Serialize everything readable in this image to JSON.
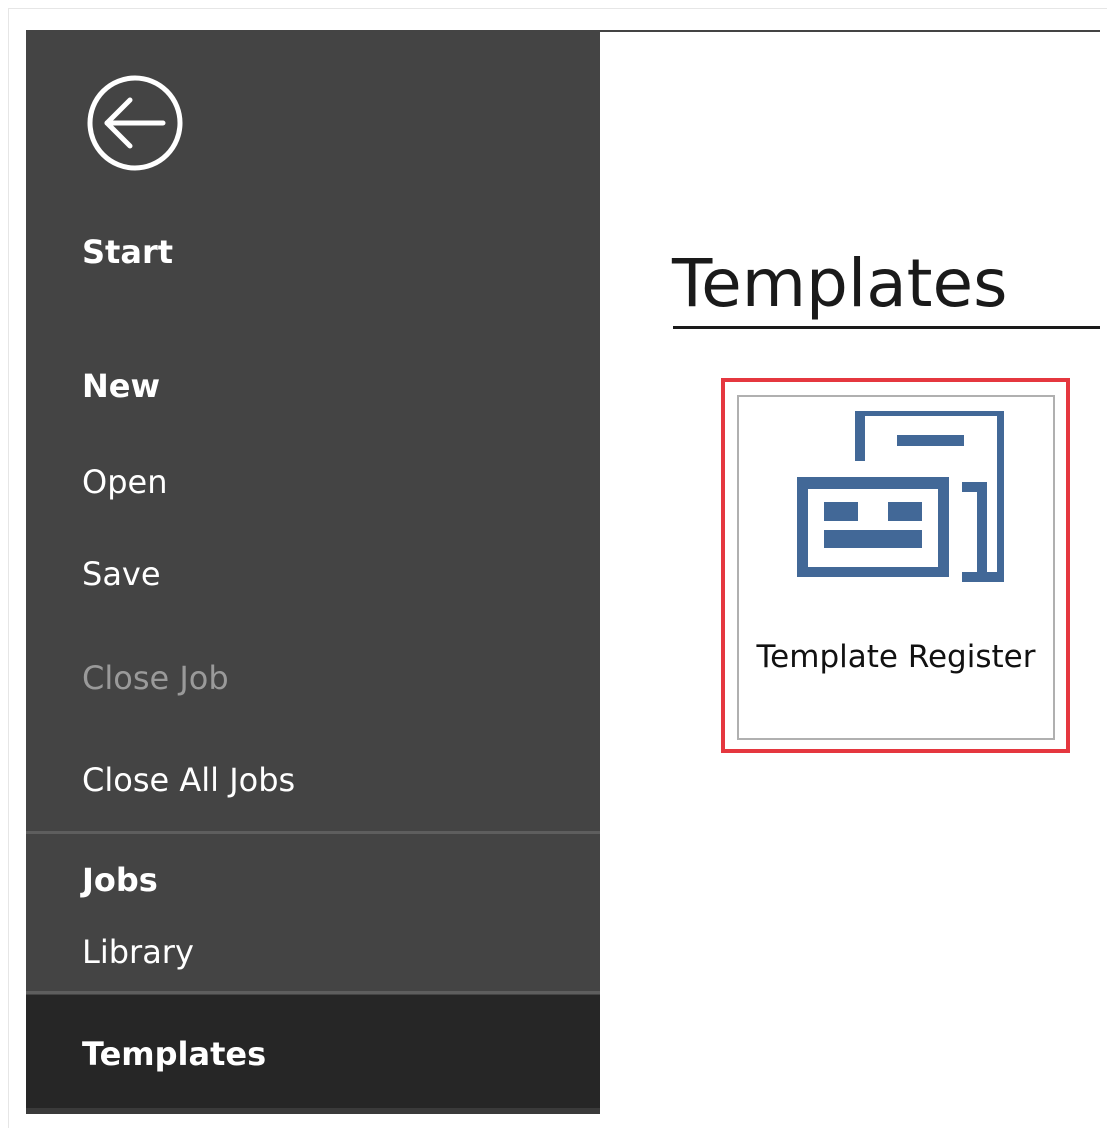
{
  "sidebar": {
    "back_icon": "back-arrow-circle-icon",
    "items": {
      "start": "Start",
      "new": "New",
      "open": "Open",
      "save": "Save",
      "close_job": "Close Job",
      "close_all_jobs": "Close All Jobs",
      "jobs": "Jobs",
      "library": "Library",
      "templates": "Templates"
    }
  },
  "main": {
    "heading": "Templates",
    "tiles": [
      {
        "label": "Template Register",
        "icon": "template-register-icon"
      }
    ]
  },
  "colors": {
    "sidebar_bg": "#444444",
    "sidebar_selected_bg": "#262626",
    "icon_blue": "#426897",
    "highlight_red": "#e5373f"
  }
}
